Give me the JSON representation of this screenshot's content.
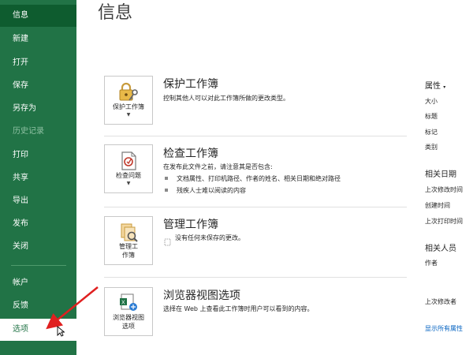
{
  "sidebar": {
    "items": [
      {
        "label": "信息"
      },
      {
        "label": "新建"
      },
      {
        "label": "打开"
      },
      {
        "label": "保存"
      },
      {
        "label": "另存为"
      },
      {
        "label": "历史记录"
      },
      {
        "label": "打印"
      },
      {
        "label": "共享"
      },
      {
        "label": "导出"
      },
      {
        "label": "发布"
      },
      {
        "label": "关闭"
      },
      {
        "label": "帐户"
      },
      {
        "label": "反馈"
      },
      {
        "label": "选项"
      }
    ]
  },
  "page": {
    "title": "信息"
  },
  "sections": {
    "protect": {
      "title": "保护工作簿",
      "desc": "控制其他人可以对此工作簿所做的更改类型。",
      "tile_label": "保护工作簿",
      "tile_icon": "lock-key-icon"
    },
    "inspect": {
      "title": "检查工作簿",
      "desc": "在发布此文件之前，请注意其是否包含:",
      "bullets": [
        "文档属性、打印机路径、作者的姓名、相关日期和绝对路径",
        "残疾人士难以阅读的内容"
      ],
      "tile_label": "检查问题",
      "tile_icon": "inspect-document-icon"
    },
    "manage": {
      "title": "管理工作簿",
      "desc": "没有任何未保存的更改。",
      "tile_label_1": "管理工",
      "tile_label_2": "作簿",
      "tile_icon": "manage-workbook-icon"
    },
    "browser": {
      "title": "浏览器视图选项",
      "desc": "选择在 Web 上查看此工作簿时用户可以看到的内容。",
      "tile_label_1": "浏览器视图",
      "tile_label_2": "选项",
      "tile_icon": "browser-view-icon"
    }
  },
  "properties": {
    "header": "属性",
    "items": [
      "大小",
      "标题",
      "标记",
      "类别"
    ],
    "dates_header": "相关日期",
    "dates": [
      "上次修改时间",
      "创建时间",
      "上次打印时间"
    ],
    "people_header": "相关人员",
    "people": [
      "作者"
    ],
    "last_modified_by": "上次修改者",
    "show_all": "显示所有属性"
  },
  "colors": {
    "sidebar_bg": "#217346",
    "arrow": "#e02020",
    "link": "#0563c1"
  }
}
